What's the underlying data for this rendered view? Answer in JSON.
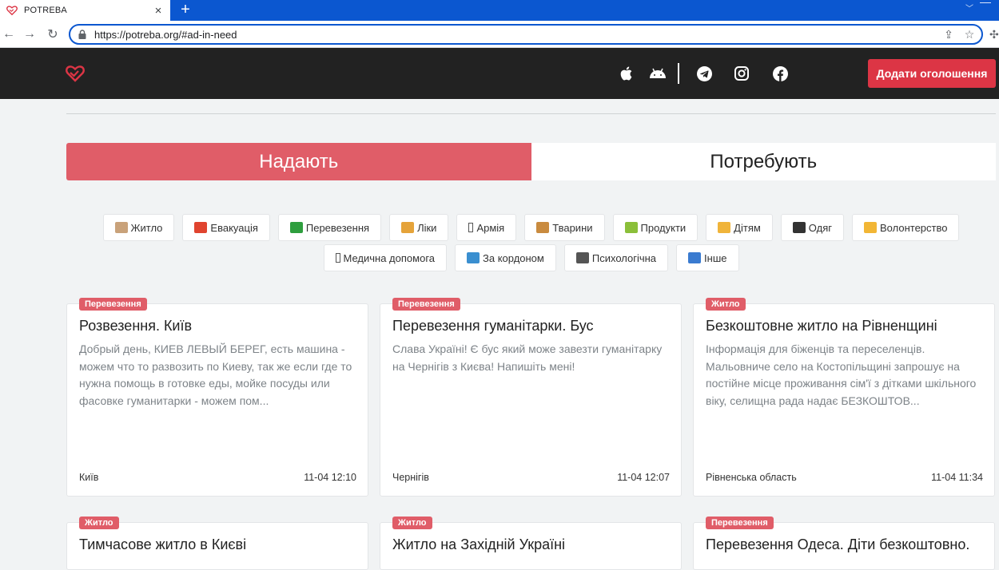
{
  "browser": {
    "tab_title": "POTREBA",
    "url": "https://potreba.org/#ad-in-need"
  },
  "header": {
    "add_button": "Додати оголошення",
    "icons": [
      "apple-icon",
      "android-icon",
      "telegram-icon",
      "instagram-icon",
      "facebook-icon"
    ]
  },
  "toggle": {
    "offer": "Надають",
    "need": "Потребують",
    "active": "offer",
    "active_color": "#e05d68"
  },
  "categories_row1": [
    {
      "label": "Житло",
      "icon": "house-icon",
      "color": "#c9a27a"
    },
    {
      "label": "Евакуація",
      "icon": "sos-icon",
      "color": "#e0442f"
    },
    {
      "label": "Перевезення",
      "icon": "car-icon",
      "color": "#2e9e3e"
    },
    {
      "label": "Ліки",
      "icon": "pill-icon",
      "color": "#e5a33a"
    },
    {
      "label": "Армія",
      "icon": "army-icon",
      "color": ""
    },
    {
      "label": "Тварини",
      "icon": "dog-icon",
      "color": "#c98b3f"
    },
    {
      "label": "Продукти",
      "icon": "food-icon",
      "color": "#8bbf3a"
    },
    {
      "label": "Дітям",
      "icon": "child-icon",
      "color": "#f0b43a"
    },
    {
      "label": "Одяг",
      "icon": "clothes-icon",
      "color": "#333333"
    },
    {
      "label": "Волонтерство",
      "icon": "hand-icon",
      "color": "#f2b635"
    }
  ],
  "categories_row2": [
    {
      "label": "Медична допомога",
      "icon": "medical-icon",
      "color": ""
    },
    {
      "label": "За кордоном",
      "icon": "map-icon",
      "color": "#3a8fd0"
    },
    {
      "label": "Психологічна",
      "icon": "speech-icon",
      "color": "#555555"
    },
    {
      "label": "Інше",
      "icon": "magnifier-icon",
      "color": "#3a7bd0"
    }
  ],
  "cards": [
    {
      "badge": "Перевезення",
      "title": "Розвезення. Київ",
      "text": "Добрый день, КИЕВ ЛЕВЫЙ БЕРЕГ, есть машина - можем что то развозить по Киеву, так же если где то нужна помощь в готовке еды, мойке посуды или фасовке гуманитарки - можем пом...",
      "city": "Київ",
      "time": "11-04 12:10"
    },
    {
      "badge": "Перевезення",
      "title": "Перевезення гуманітарки. Бус",
      "text": "Слава Україні! Є бус який може завезти гуманітарку на Чернігів з Києва! Напишіть мені!",
      "city": "Чернігів",
      "time": "11-04 12:07"
    },
    {
      "badge": "Житло",
      "title": "Безкоштовне житло на Рівненщині",
      "text": "Інформація для біженців та переселенців. Мальовниче село на Костопільщині запрошує на постійне місце проживання сім'ї з дітками шкільного віку, селищна рада надає БЕЗКОШТОВ...",
      "city": "Рівненська область",
      "time": "11-04 11:34"
    },
    {
      "badge": "Житло",
      "title": "Тимчасове житло в Києві"
    },
    {
      "badge": "Житло",
      "title": "Житло на Західній Україні"
    },
    {
      "badge": "Перевезення",
      "title": "Перевезення Одеса. Діти безкоштовно."
    }
  ]
}
